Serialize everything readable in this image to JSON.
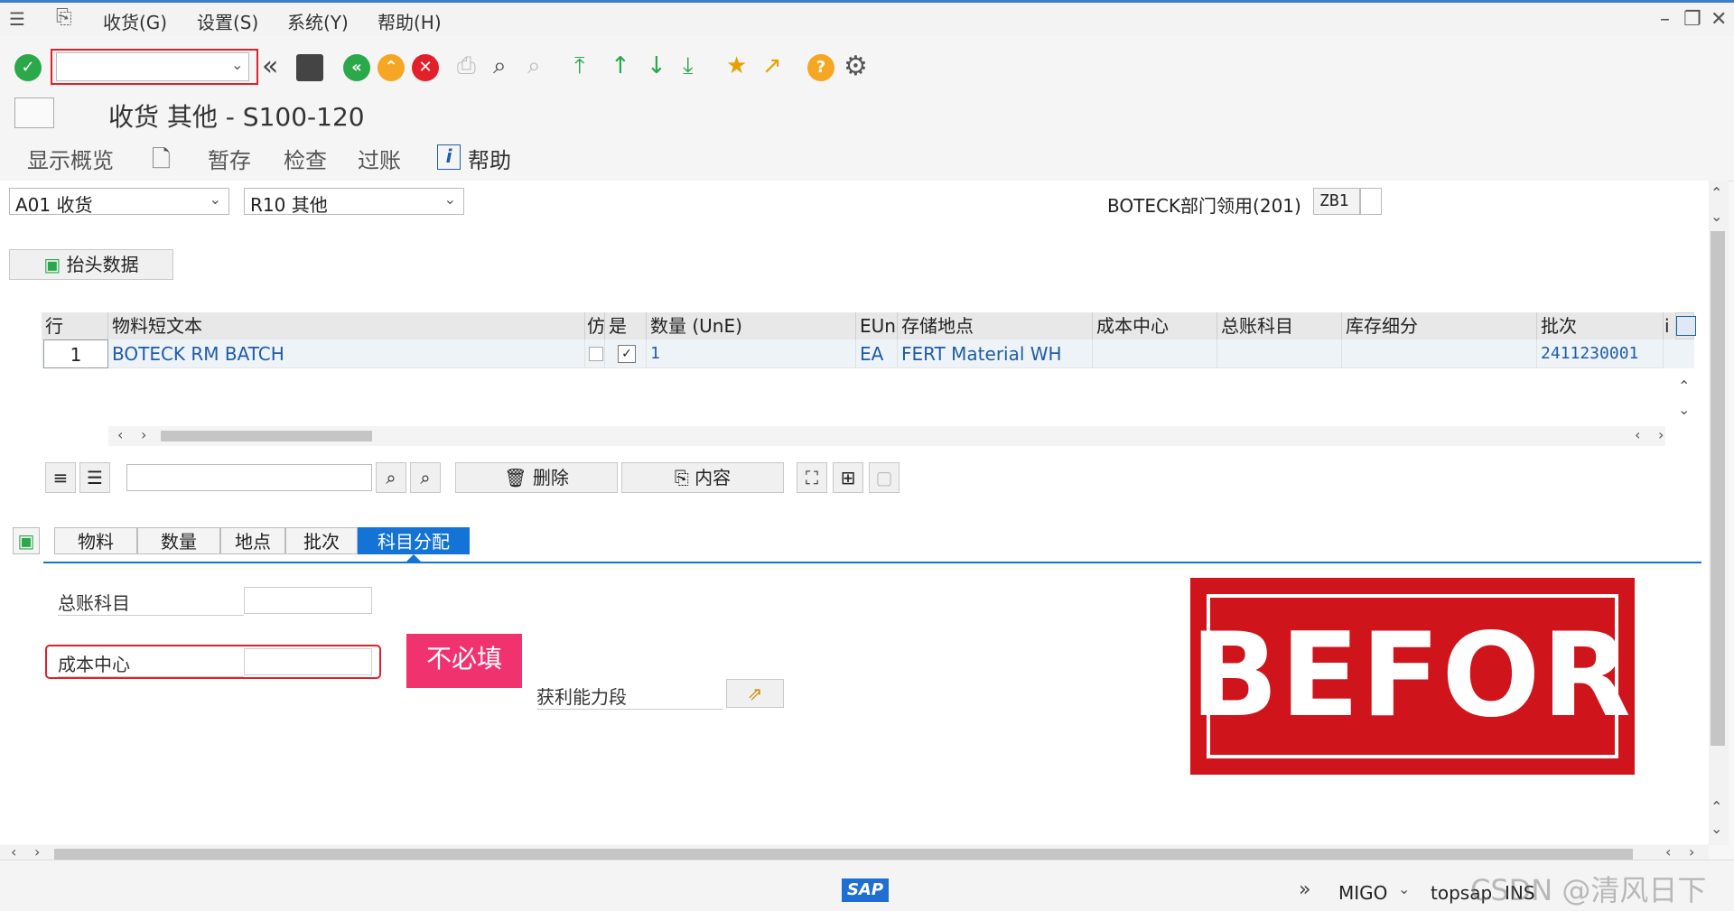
{
  "menu": {
    "items": [
      "收货(G)",
      "设置(S)",
      "系统(Y)",
      "帮助(H)"
    ]
  },
  "toolbar": {
    "command_value": ""
  },
  "window": {
    "title": "收货 其他 - S100-120"
  },
  "appbar": {
    "overview": "显示概览",
    "hold": "暂存",
    "check": "检查",
    "post": "过账",
    "help": "帮助"
  },
  "header": {
    "action_value": "A01 收货",
    "ref_value": "R10 其他",
    "movement_text": "BOTECK部门领用(201)",
    "movement_code": "ZB1",
    "header_data_button": "抬头数据"
  },
  "table": {
    "columns": [
      "行",
      "物料短文本",
      "仿",
      "是",
      "数量 (UnE)",
      "EUn",
      "存储地点",
      "成本中心",
      "总账科目",
      "库存细分",
      "批次",
      "i"
    ],
    "rows": [
      {
        "line": "1",
        "material": "BOTECK RM BATCH",
        "qty": "1",
        "unit": "EA",
        "sloc": "FERT Material WH",
        "cost_center": "",
        "gl": "",
        "stock_seg": "",
        "batch": "2411230001"
      }
    ]
  },
  "grid_toolbar": {
    "search_value": "",
    "delete_label": "删除",
    "content_label": "内容"
  },
  "tabs": [
    "物料",
    "数量",
    "地点",
    "批次",
    "科目分配"
  ],
  "detail": {
    "gl_label": "总账科目",
    "gl_value": "",
    "cc_label": "成本中心",
    "cc_value": "",
    "profit_label": "获利能力段",
    "annotation": "不必填",
    "stamp_text": "BEFORE"
  },
  "status": {
    "tcode": "MIGO",
    "system": "topsap",
    "mode": "INS",
    "logo": "SAP",
    "watermark": "CSDN @清风日下"
  },
  "colors": {
    "accent": "#1473d6",
    "highlight_red": "#e0202a",
    "annotation_pink": "#f0326e",
    "stamp_red": "#d0141c"
  }
}
